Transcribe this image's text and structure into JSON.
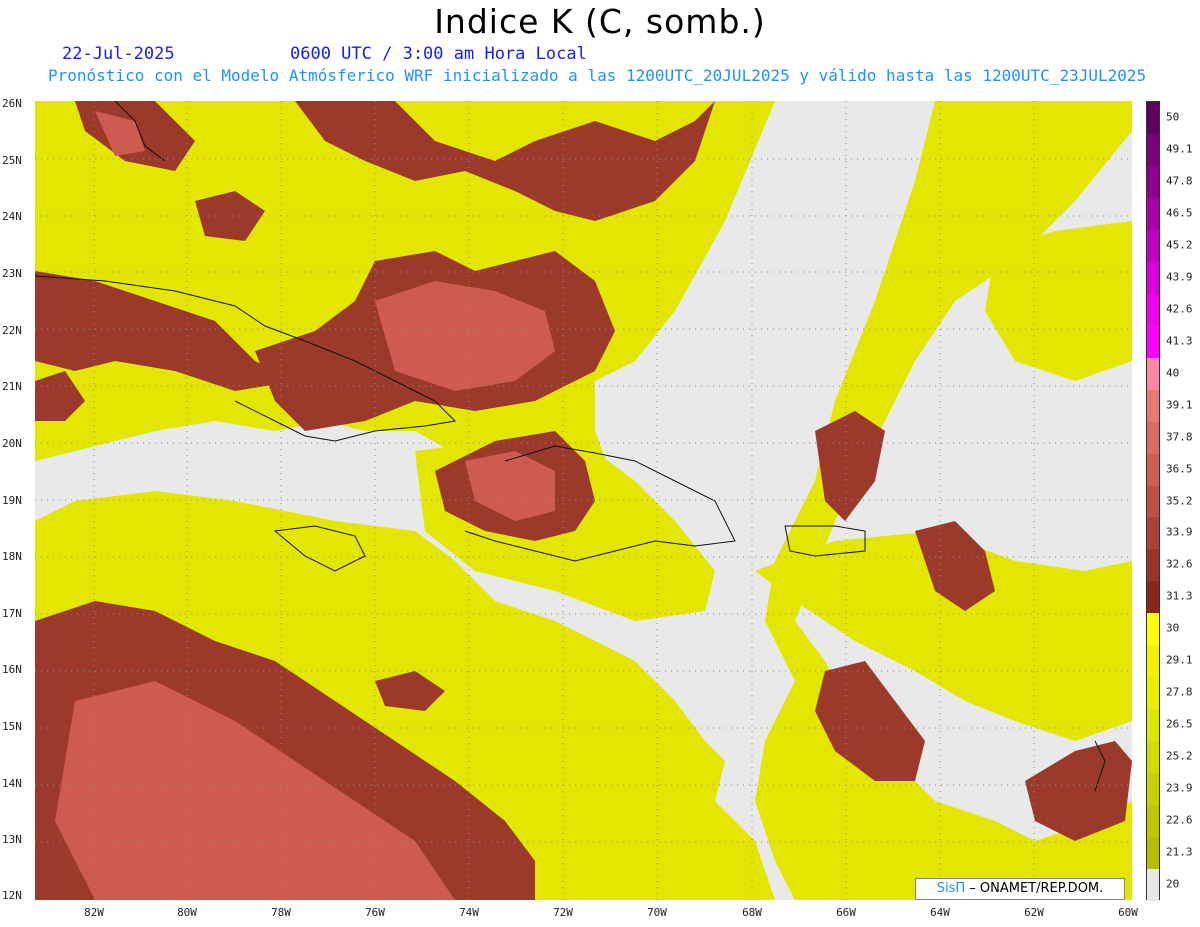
{
  "header": {
    "title": "Indice K (C, somb.)",
    "date": "22-Jul-2025",
    "time": "0600 UTC / 3:00 am Hora Local",
    "subtitle": "Pronóstico con el Modelo Atmósferico WRF inicializado a las 1200UTC_20JUL2025 y válido hasta las  1200UTC_23JUL2025"
  },
  "axes": {
    "lat_labels": [
      "26N",
      "25N",
      "24N",
      "23N",
      "22N",
      "21N",
      "20N",
      "19N",
      "18N",
      "17N",
      "16N",
      "15N",
      "14N",
      "13N",
      "12N"
    ],
    "lon_labels": [
      "82W",
      "80W",
      "78W",
      "76W",
      "74W",
      "72W",
      "70W",
      "68W",
      "66W",
      "64W",
      "62W",
      "60W"
    ]
  },
  "colorbar": {
    "labels": [
      "50",
      "49.1",
      "47.8",
      "46.5",
      "45.2",
      "43.9",
      "42.6",
      "41.3",
      "40",
      "39.1",
      "37.8",
      "36.5",
      "35.2",
      "33.9",
      "32.6",
      "31.3",
      "30",
      "29.1",
      "27.8",
      "26.5",
      "25.2",
      "23.9",
      "22.6",
      "21.3",
      "20"
    ],
    "colors": [
      "#600060",
      "#7a007a",
      "#900090",
      "#a800a8",
      "#c000c0",
      "#d800d8",
      "#ee00ee",
      "#ff00ff",
      "#ff88a0",
      "#e97a72",
      "#dc6c62",
      "#cf5e52",
      "#c05044",
      "#ad4236",
      "#9a3428",
      "#88281a",
      "#ffff00",
      "#f3f300",
      "#e8ee00",
      "#dde600",
      "#d2dc00",
      "#c7d200",
      "#bdc800",
      "#b3be00",
      "#e8e8e8"
    ]
  },
  "credit": {
    "brand": "SisΠ",
    "text": " – ONAMET/REP.DOM."
  }
}
